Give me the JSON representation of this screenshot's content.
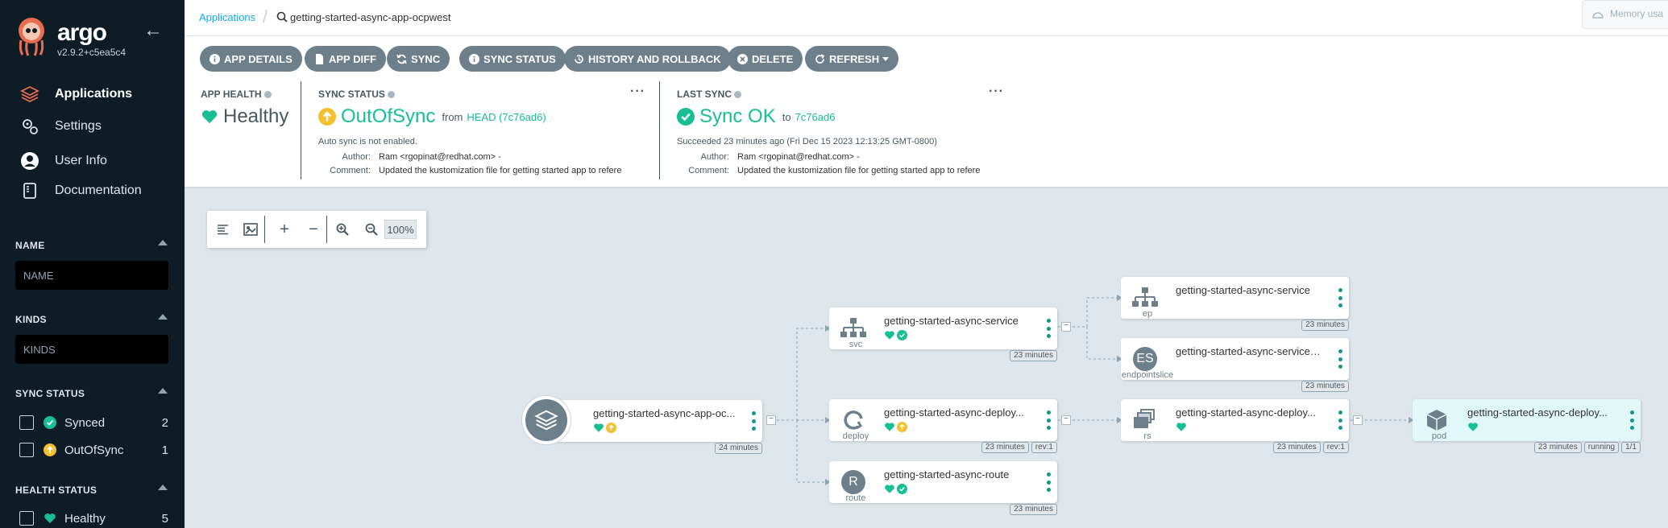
{
  "sidebar": {
    "brand": "argo",
    "version": "v2.9.2+c5ea5c4",
    "nav": [
      {
        "label": "Applications",
        "icon": "layers-icon"
      },
      {
        "label": "Settings",
        "icon": "gears-icon"
      },
      {
        "label": "User Info",
        "icon": "user-circle-icon"
      },
      {
        "label": "Documentation",
        "icon": "book-icon"
      }
    ],
    "filters": {
      "name_title": "NAME",
      "name_placeholder": "NAME",
      "kinds_title": "KINDS",
      "kinds_placeholder": "KINDS",
      "sync_title": "SYNC STATUS",
      "sync_items": [
        {
          "label": "Synced",
          "count": "2"
        },
        {
          "label": "OutOfSync",
          "count": "1"
        }
      ],
      "health_title": "HEALTH STATUS",
      "health_items": [
        {
          "label": "Healthy",
          "count": "5"
        }
      ]
    }
  },
  "topbar": {
    "breadcrumb_root": "Applications",
    "breadcrumb_current": "getting-started-async-app-ocpwest",
    "memory_label": "Memory usa"
  },
  "toolbar": {
    "buttons": [
      "APP DETAILS",
      "APP DIFF",
      "SYNC",
      "SYNC STATUS",
      "HISTORY AND ROLLBACK",
      "DELETE",
      "REFRESH"
    ]
  },
  "status": {
    "app_health_label": "APP HEALTH",
    "app_health_value": "Healthy",
    "sync_status_label": "SYNC STATUS",
    "sync_status_value": "OutOfSync",
    "sync_from": "from",
    "sync_revision": "HEAD (7c76ad6)",
    "auto_sync": "Auto sync is not enabled.",
    "author_key": "Author:",
    "author_value": "Ram <rgopinat@redhat.com> -",
    "comment_key": "Comment:",
    "comment_value": "Updated the kustomization file for getting started app to refere",
    "last_sync_label": "LAST SYNC",
    "last_sync_value": "Sync OK",
    "last_sync_to": "to",
    "last_sync_revision": "7c76ad6",
    "last_sync_time": "Succeeded 23 minutes ago (Fri Dec 15 2023 12:13:25 GMT-0800)",
    "last_author_value": "Ram <rgopinat@redhat.com> -",
    "last_comment_value": "Updated the kustomization file for getting started app to refere"
  },
  "graph": {
    "zoom_level": "100%",
    "nodes": {
      "app": {
        "name": "getting-started-async-app-oc...",
        "age": "24 minutes"
      },
      "svc": {
        "name": "getting-started-async-service",
        "kind": "svc",
        "age": "23 minutes"
      },
      "deploy": {
        "name": "getting-started-async-deploy...",
        "kind": "deploy",
        "age": "23 minutes",
        "rev": "rev:1"
      },
      "route": {
        "name": "getting-started-async-route",
        "kind": "route",
        "age": "23 minutes",
        "letter": "R"
      },
      "ep": {
        "name": "getting-started-async-service",
        "kind": "ep",
        "age": "23 minutes"
      },
      "endpointslice": {
        "name": "getting-started-async-service-...",
        "kind": "endpointslice",
        "age": "23 minutes",
        "letter": "ES"
      },
      "rs": {
        "name": "getting-started-async-deploy...",
        "kind": "rs",
        "age": "23 minutes",
        "rev": "rev:1"
      },
      "pod": {
        "name": "getting-started-async-deploy...",
        "kind": "pod",
        "age": "23 minutes",
        "state": "running",
        "ready": "1/1"
      }
    }
  },
  "colors": {
    "healthy": "#18be94",
    "outofsync": "#f4c030",
    "sidebar_bg": "#0e1c26",
    "link": "#0dadea",
    "button": "#6d7f8b"
  }
}
